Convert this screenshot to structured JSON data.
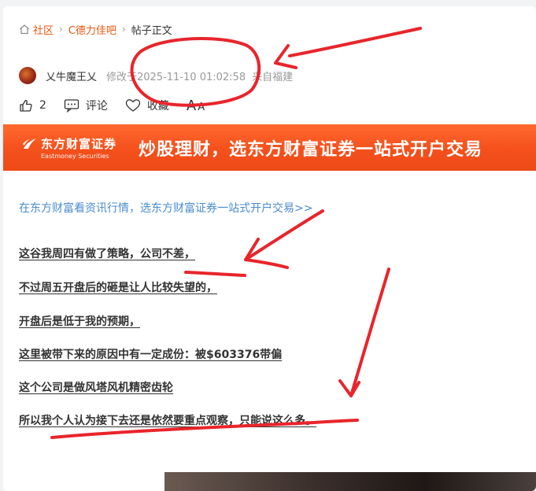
{
  "breadcrumb": {
    "items": [
      "社区",
      "C德力佳吧"
    ],
    "current": "帖子正文"
  },
  "author": {
    "name": "乂牛魔王乂",
    "modified": "修改于2025-11-10 01:02:58",
    "location": "来自福建"
  },
  "actions": {
    "like_count": "2",
    "comment_label": "评论",
    "favorite_label": "收藏",
    "font_big": "A",
    "font_small": "A"
  },
  "banner": {
    "logo_cn": "东方财富证券",
    "logo_en": "Eastmoney Securities",
    "slogan": "炒股理财，选东方财富证券一站式开户交易"
  },
  "promo_link": "在东方财富看资讯行情，选东方财富证券一站式开户交易>>",
  "post_lines": [
    "这谷我周四有做了策略，公司不差，",
    "不过周五开盘后的砸是让人比较失望的，",
    "开盘后是低于我的预期，",
    "这里被带下来的原因中有一定成份：被$603376带偏",
    "这个公司是做风塔风机精密齿轮",
    "所以我个人认为接下去还是依然要重点观察，只能说这么多。"
  ],
  "colors": {
    "accent": "#e8570f",
    "banner": "#f4501c",
    "link": "#4a8ccf",
    "annotation": "#e8252b"
  }
}
